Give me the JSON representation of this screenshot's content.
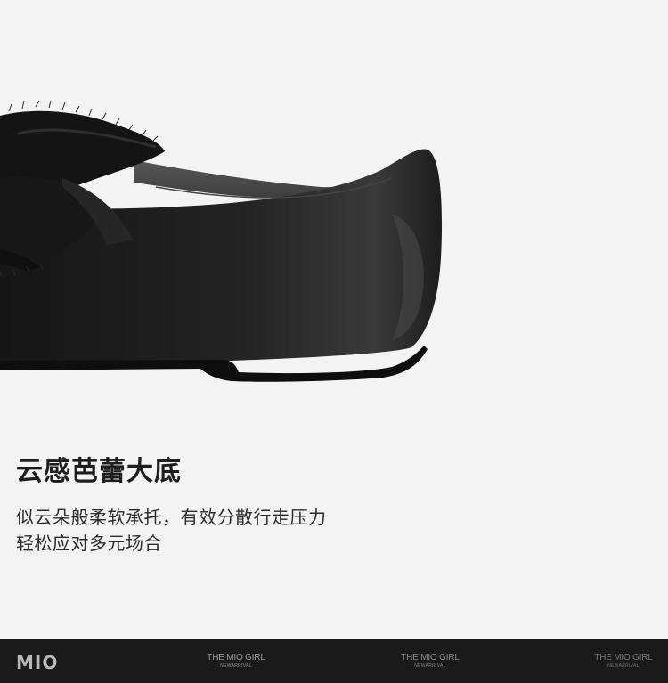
{
  "headline": "云感芭蕾大底",
  "description": {
    "line1": "似云朵般柔软承托，有效分散行走压力",
    "line2": "轻松应对多元场合"
  },
  "footer": {
    "logo": "MIO",
    "tags": [
      {
        "title": "THE MIO GIRL",
        "subtitle": "NEWARRIVAL"
      },
      {
        "title": "THE MIO GIRL",
        "subtitle": "NEWARRIVAL"
      },
      {
        "title": "THE MIO GIRL",
        "subtitle": "NEWARRIVAL"
      }
    ]
  },
  "colors": {
    "background": "#f3f3f3",
    "footer": "#1a1a1a",
    "shoe": "#1b1b1b"
  }
}
